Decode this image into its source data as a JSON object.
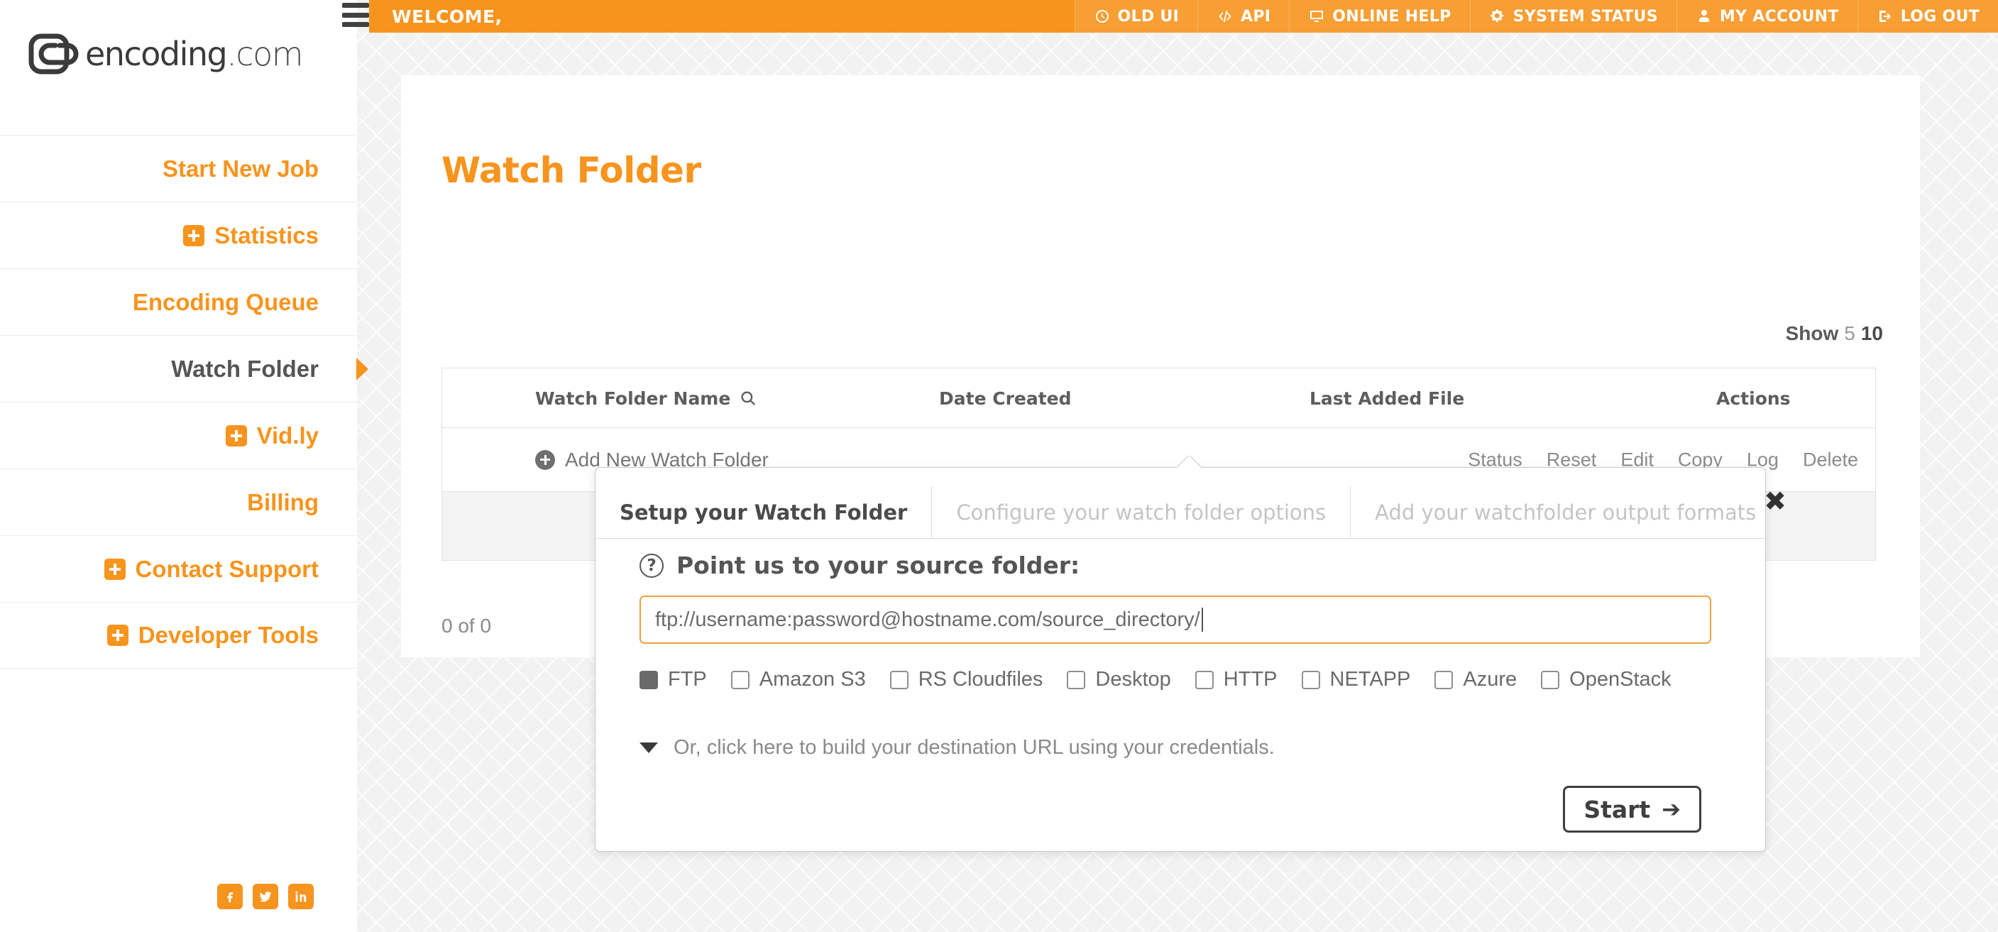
{
  "brand": {
    "logo_text_main": "encoding",
    "logo_text_suffix": ".com",
    "accent_color": "#f7941e"
  },
  "topbar": {
    "welcome": "WELCOME,",
    "links": [
      {
        "label": "OLD UI",
        "icon": "clock-icon"
      },
      {
        "label": "API",
        "icon": "code-icon"
      },
      {
        "label": "ONLINE HELP",
        "icon": "monitor-icon"
      },
      {
        "label": "SYSTEM STATUS",
        "icon": "gears-icon"
      },
      {
        "label": "MY ACCOUNT",
        "icon": "user-icon"
      },
      {
        "label": "LOG OUT",
        "icon": "logout-icon"
      }
    ]
  },
  "sidebar": {
    "items": [
      {
        "label": "Start New Job",
        "expandable": false,
        "active": false
      },
      {
        "label": "Statistics",
        "expandable": true,
        "active": false
      },
      {
        "label": "Encoding Queue",
        "expandable": false,
        "active": false
      },
      {
        "label": "Watch Folder",
        "expandable": false,
        "active": true
      },
      {
        "label": "Vid.ly",
        "expandable": true,
        "active": false
      },
      {
        "label": "Billing",
        "expandable": false,
        "active": false
      },
      {
        "label": "Contact Support",
        "expandable": true,
        "active": false
      },
      {
        "label": "Developer Tools",
        "expandable": true,
        "active": false
      }
    ],
    "social": [
      {
        "name": "facebook-icon"
      },
      {
        "name": "twitter-icon"
      },
      {
        "name": "linkedin-icon"
      }
    ]
  },
  "main": {
    "title": "Watch Folder",
    "show": {
      "label": "Show",
      "options": [
        "5",
        "10"
      ],
      "selected": "10"
    },
    "table": {
      "columns": [
        "Watch Folder Name",
        "Date Created",
        "Last Added File",
        "Actions"
      ],
      "add_row_label": "Add New Watch Folder",
      "row_actions": [
        "Status",
        "Reset",
        "Edit",
        "Copy",
        "Log",
        "Delete"
      ]
    },
    "pager": "0 of 0"
  },
  "modal": {
    "close_label": "✖",
    "tabs": [
      {
        "label": "Setup your Watch Folder",
        "active": true
      },
      {
        "label": "Configure your watch folder options",
        "active": false
      },
      {
        "label": "Add your watchfolder output formats",
        "active": false
      }
    ],
    "help_icon_label": "?",
    "heading": "Point us to your source folder:",
    "url_field": {
      "value": "ftp://username:password@hostname.com/source_directory/",
      "placeholder": "ftp://username:password@hostname.com/source_directory/"
    },
    "sources": [
      {
        "label": "FTP",
        "checked": true
      },
      {
        "label": "Amazon S3",
        "checked": false
      },
      {
        "label": "RS Cloudfiles",
        "checked": false
      },
      {
        "label": "Desktop",
        "checked": false
      },
      {
        "label": "HTTP",
        "checked": false
      },
      {
        "label": "NETAPP",
        "checked": false
      },
      {
        "label": "Azure",
        "checked": false
      },
      {
        "label": "OpenStack",
        "checked": false
      }
    ],
    "build_url_label": "Or, click here to build your destination URL using your credentials.",
    "start_label": "Start",
    "start_arrow": "➔"
  }
}
